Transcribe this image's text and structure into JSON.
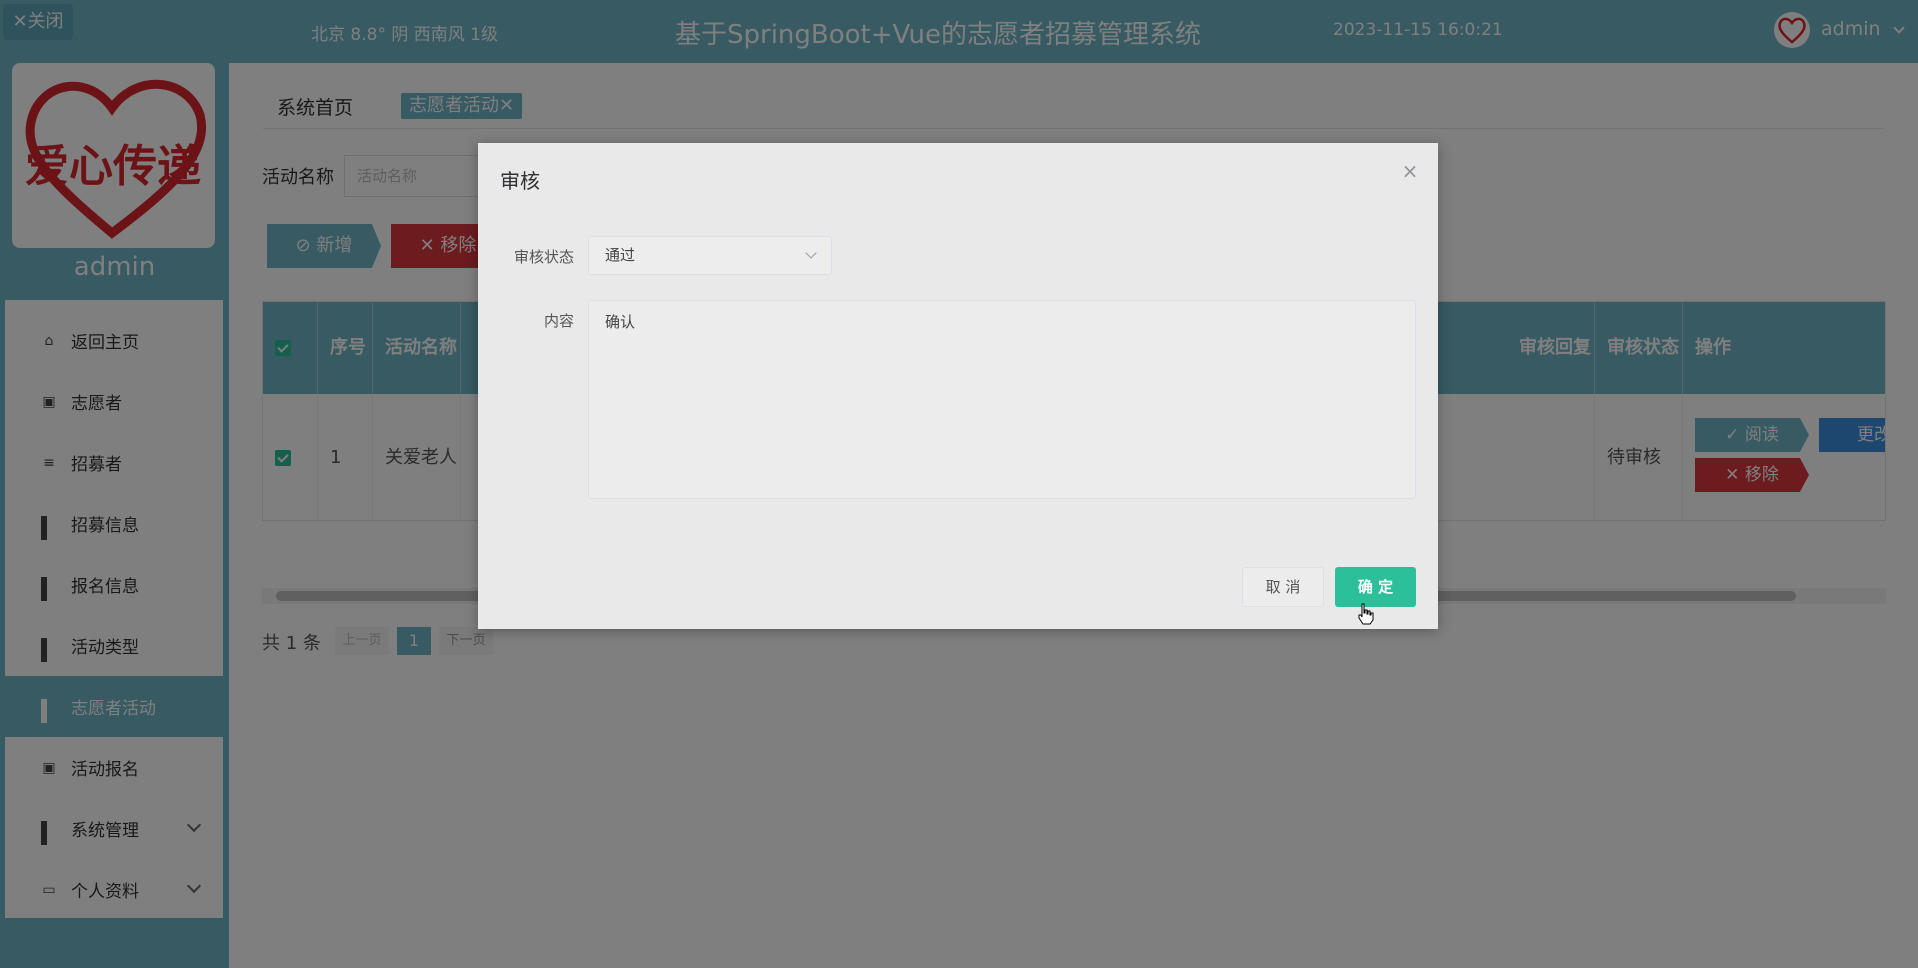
{
  "app": {
    "title": "基于SpringBoot+Vue的志愿者招募管理系统",
    "weather": "北京  8.8°  阴  西南风  1级",
    "datetime": "2023-11-15 16:0:21",
    "user": "admin",
    "close_label": "✕关闭",
    "sidebar_admin": "admin",
    "logo_text": "爱心传递"
  },
  "colors": {
    "primary": "#6fb5c7",
    "danger": "#d9363e",
    "confirm": "#2bbf9a"
  },
  "sidebar": {
    "items": [
      {
        "label": "返回主页",
        "icon": "home-icon"
      },
      {
        "label": "志愿者",
        "icon": "clipboard-icon"
      },
      {
        "label": "招募者",
        "icon": "list-icon"
      },
      {
        "label": "招募信息",
        "icon": "grid-icon"
      },
      {
        "label": "报名信息",
        "icon": "grid-icon"
      },
      {
        "label": "活动类型",
        "icon": "grid-icon"
      },
      {
        "label": "志愿者活动",
        "icon": "grid-icon",
        "active": true
      },
      {
        "label": "活动报名",
        "icon": "clipboard-icon"
      },
      {
        "label": "系统管理",
        "icon": "grid-icon",
        "expandable": true
      },
      {
        "label": "个人资料",
        "icon": "card-icon",
        "expandable": true
      }
    ]
  },
  "tabs": {
    "home": "系统首页",
    "active": "志愿者活动✕"
  },
  "search": {
    "label": "活动名称",
    "placeholder": "活动名称"
  },
  "toolbar": {
    "add_label": "⊘ 新增",
    "remove_label": "✕ 移除"
  },
  "table": {
    "columns": {
      "index": "序号",
      "name": "活动名称",
      "reply": "审核回复",
      "status": "审核状态",
      "ops": "操作"
    },
    "rows": [
      {
        "index": "1",
        "name": "关爱老人",
        "reply": "",
        "status": "待审核"
      }
    ],
    "row_actions": {
      "read": "✓ 阅读",
      "edit": "更改",
      "remove": "✕ 移除"
    }
  },
  "pager": {
    "total": "共 1 条",
    "prev": "上一页",
    "current": "1",
    "next": "下一页"
  },
  "dialog": {
    "title": "审核",
    "status_label": "审核状态",
    "status_value": "通过",
    "content_label": "内容",
    "content_value": "确认",
    "cancel_label": "取 消",
    "ok_label": "确 定"
  }
}
